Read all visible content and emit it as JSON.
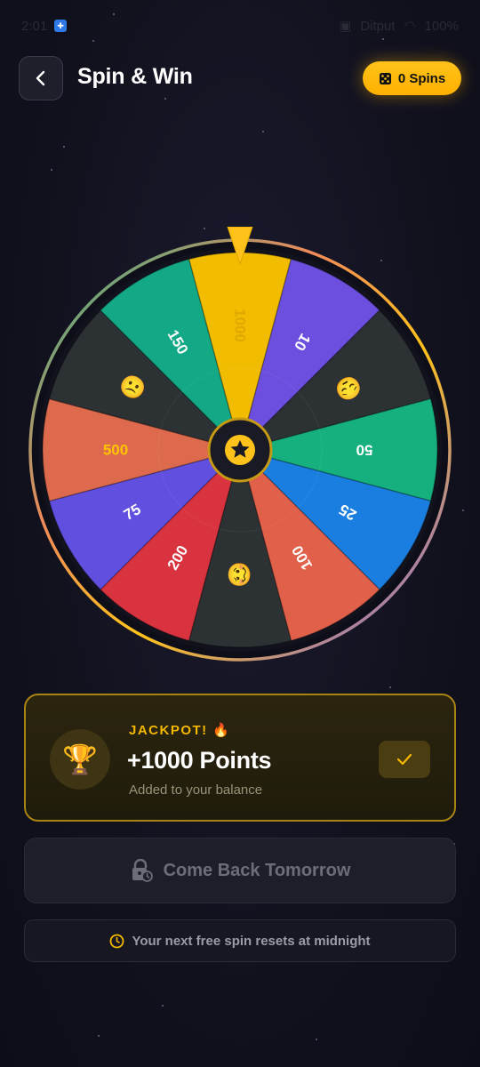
{
  "status_bar": {
    "time": "2:01",
    "signal_text": "Ditput",
    "battery": "100%"
  },
  "header": {
    "title": "Spin & Win",
    "spins_label": "0 Spins"
  },
  "wheel": {
    "pointer_color": "#ffc21a",
    "center_icon": "star-icon",
    "segments": [
      {
        "label": "1000",
        "color": "#f2bd00",
        "kind": "text",
        "text_color": "#e0a800"
      },
      {
        "label": "10",
        "color": "#6d4fe0",
        "kind": "text",
        "text_color": "#ffffff"
      },
      {
        "label": "😔",
        "color": "#2c3133",
        "kind": "emoji",
        "text_color": "#ffffff"
      },
      {
        "label": "50",
        "color": "#16b07f",
        "kind": "text",
        "text_color": "#ffffff"
      },
      {
        "label": "25",
        "color": "#1a7ee0",
        "kind": "text",
        "text_color": "#ffffff"
      },
      {
        "label": "100",
        "color": "#e0604a",
        "kind": "text",
        "text_color": "#ffffff"
      },
      {
        "label": "🥴",
        "color": "#2c3133",
        "kind": "emoji",
        "text_color": "#ffffff"
      },
      {
        "label": "200",
        "color": "#d9333f",
        "kind": "text",
        "text_color": "#ffffff"
      },
      {
        "label": "75",
        "color": "#6150e0",
        "kind": "text",
        "text_color": "#ffffff"
      },
      {
        "label": "500",
        "color": "#dd6a4c",
        "kind": "text",
        "text_color": "#ffc400"
      },
      {
        "label": "😕",
        "color": "#2c3133",
        "kind": "emoji",
        "text_color": "#ffffff"
      },
      {
        "label": "150",
        "color": "#13a886",
        "kind": "text",
        "text_color": "#ffffff"
      }
    ]
  },
  "result": {
    "badge": "JACKPOT! 🔥",
    "points": "+1000 Points",
    "note": "Added to your balance",
    "icon": "trophy-icon"
  },
  "come_back_label": "Come Back Tomorrow",
  "reset_text": "Your next free spin resets at midnight"
}
